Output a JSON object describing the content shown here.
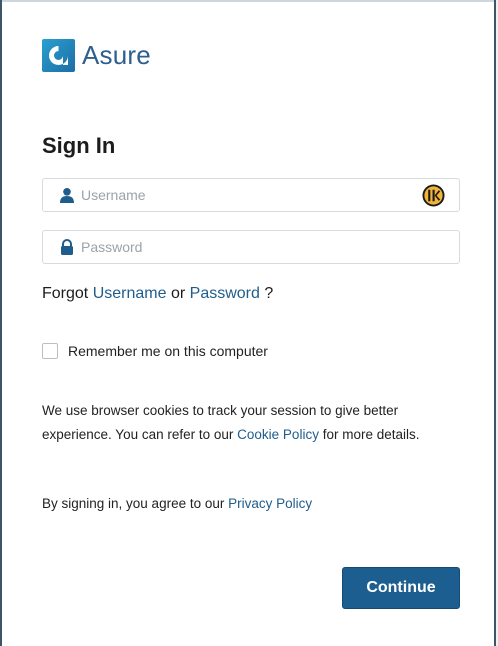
{
  "brand": {
    "name": "Asure",
    "logo_icon": "asure-logo-icon",
    "color": "#2f5f8f"
  },
  "form": {
    "title": "Sign In",
    "username": {
      "icon": "user-icon",
      "value": "",
      "placeholder": "Username"
    },
    "password": {
      "icon": "lock-icon",
      "value": "",
      "placeholder": "Password"
    },
    "password_manager_icon": "keeper-icon",
    "forgot": {
      "prefix": "Forgot",
      "username_link": "Username",
      "or": "or",
      "password_link": "Password",
      "suffix": "?"
    },
    "remember": {
      "label": "Remember me on this computer",
      "checked": false
    },
    "cookie_notice": {
      "text_before": "We use browser cookies to track your session to give better experience. You can refer to our",
      "link": "Cookie Policy",
      "text_after": "for more details."
    },
    "agreement": {
      "text": "By signing in, you agree to our",
      "link": "Privacy Policy"
    },
    "continue_label": "Continue"
  },
  "colors": {
    "accent": "#1c5e8f",
    "link": "#1f5d8c",
    "text": "#1c1c1c"
  }
}
